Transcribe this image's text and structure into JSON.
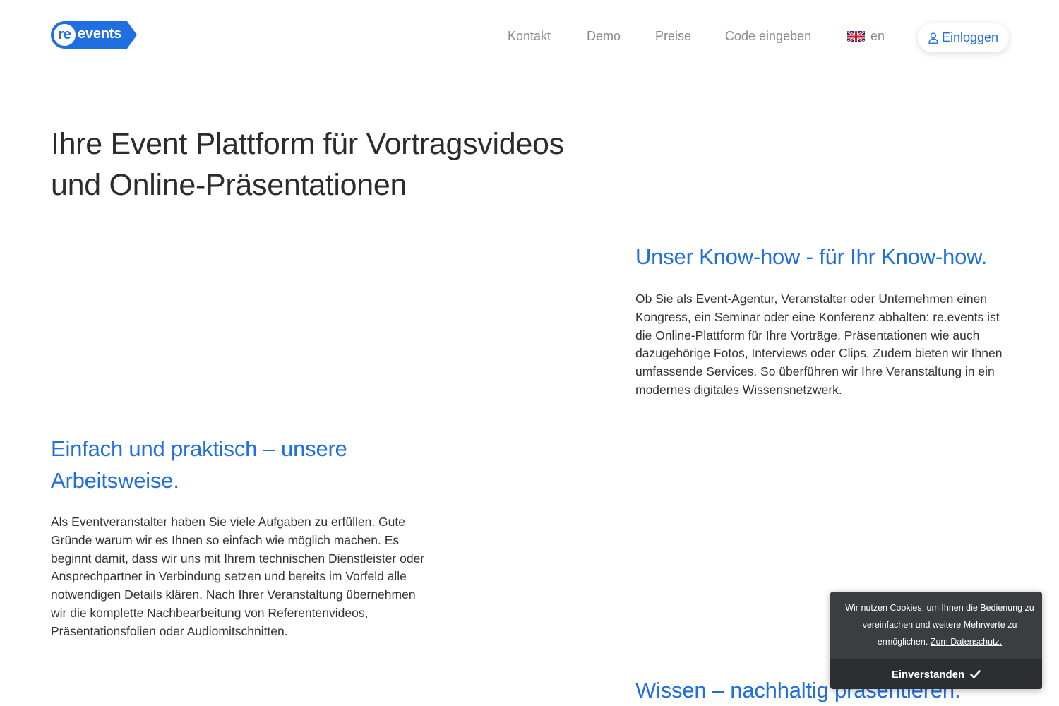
{
  "brand": {
    "logo_re": "re",
    "logo_events": "events",
    "color": "#1f6fe0"
  },
  "nav": {
    "items": [
      {
        "label": "Kontakt"
      },
      {
        "label": "Demo"
      },
      {
        "label": "Preise"
      },
      {
        "label": "Code eingeben"
      }
    ],
    "language": {
      "label": "en",
      "icon": "uk-flag-icon"
    },
    "login": {
      "label": "Einloggen",
      "icon": "user-icon"
    }
  },
  "hero": {
    "title_line1": "Ihre Event Plattform für Vortragsvideos",
    "title_line2": "und Online-Präsentationen"
  },
  "sections": [
    {
      "title": "Unser Know-how - für Ihr Know-how.",
      "text": "Ob Sie als Event-Agentur, Veranstalter oder Unternehmen einen Kongress, ein Seminar oder eine Konferenz abhalten: re.events ist die Online-Plattform für Ihre Vorträge, Präsentationen wie auch dazugehörige Fotos, Interviews oder Clips. Zudem bieten wir Ihnen umfassende Services. So überführen wir Ihre Veranstaltung in ein modernes digitales Wissensnetzwerk."
    },
    {
      "title": "Einfach und praktisch – unsere Arbeitsweise.",
      "text": "Als Eventveranstalter haben Sie viele Aufgaben zu erfüllen. Gute Gründe warum wir es Ihnen so einfach wie möglich machen. Es beginnt damit, dass wir uns mit Ihrem technischen Dienstleister oder Ansprechpartner in Verbindung setzen und bereits im Vorfeld alle notwendigen Details klären. Nach Ihrer Veranstaltung übernehmen wir die komplette Nachbearbeitung von Referentenvideos, Präsentationsfolien oder Audiomitschnitten."
    },
    {
      "title": "Wissen – nachhaltig präsentieren."
    }
  ],
  "cookie": {
    "text": "Wir nutzen Cookies, um Ihnen die Bedienung zu vereinfachen und weitere Mehrwerte zu ermöglichen.",
    "link": "Zum Datenschutz.",
    "button": "Einverstanden",
    "button_icon": "check-icon"
  }
}
